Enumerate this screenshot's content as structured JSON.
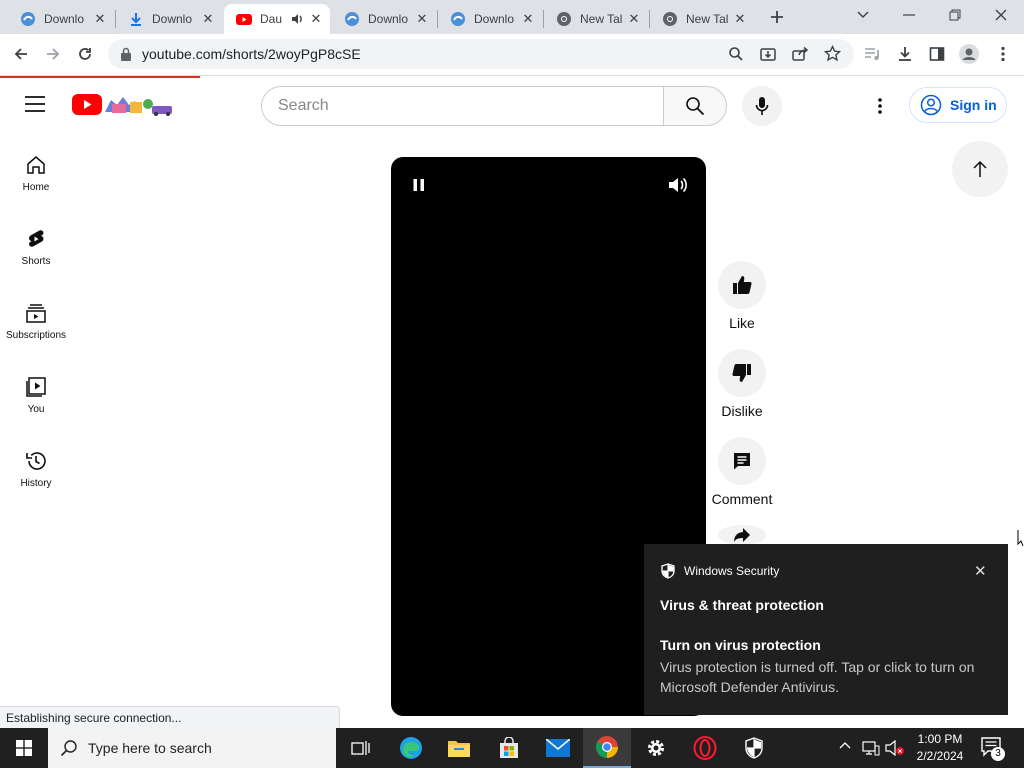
{
  "browser": {
    "tabs": [
      {
        "title": "Downlo",
        "icon": "download-site-icon",
        "active": false
      },
      {
        "title": "Downlo",
        "icon": "download-arrow-icon",
        "active": false
      },
      {
        "title": "Dau",
        "icon": "youtube-icon",
        "active": true,
        "audio": true
      },
      {
        "title": "Downlo",
        "icon": "download-site-icon",
        "active": false
      },
      {
        "title": "Downlo",
        "icon": "download-site-icon",
        "active": false
      },
      {
        "title": "New Tal",
        "icon": "chrome-icon",
        "active": false
      },
      {
        "title": "New Tal",
        "icon": "chrome-icon",
        "active": false
      }
    ],
    "url": "youtube.com/shorts/2woyPgP8cSE",
    "status_text": "Establishing secure connection..."
  },
  "youtube": {
    "search_placeholder": "Search",
    "sign_in_label": "Sign in",
    "nav": [
      {
        "label": "Home",
        "icon": "home-icon"
      },
      {
        "label": "Shorts",
        "icon": "shorts-icon"
      },
      {
        "label": "Subscriptions",
        "icon": "subscriptions-icon"
      },
      {
        "label": "You",
        "icon": "you-icon"
      },
      {
        "label": "History",
        "icon": "history-icon"
      }
    ],
    "actions": {
      "like": "Like",
      "dislike": "Dislike",
      "comment": "Comment"
    }
  },
  "toast": {
    "app_name": "Windows Security",
    "title": "Virus & threat protection",
    "heading": "Turn on virus protection",
    "body": "Virus protection is turned off. Tap or click to turn on Microsoft Defender Antivirus."
  },
  "taskbar": {
    "search_placeholder": "Type here to search",
    "time": "1:00 PM",
    "date": "2/2/2024",
    "notification_count": "3"
  },
  "colors": {
    "youtube_red": "#ff0000",
    "link_blue": "#065fd4",
    "taskbar": "#202020"
  }
}
